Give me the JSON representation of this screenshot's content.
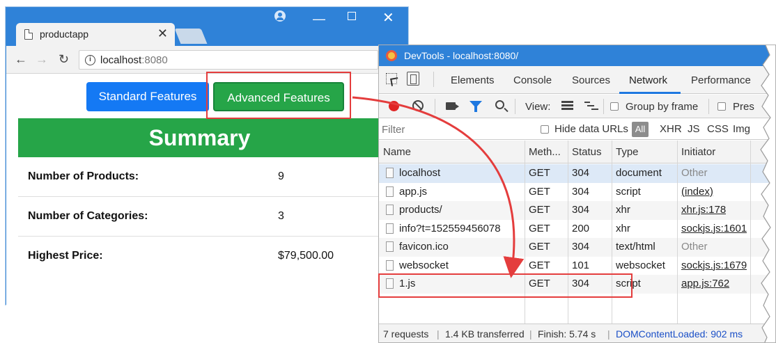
{
  "browser": {
    "tab_title": "productapp",
    "tab_close": "✕",
    "url_host": "localhost",
    "url_port": ":8080",
    "buttons": {
      "standard": "Standard Features",
      "advanced": "Advanced Features"
    },
    "summary_title": "Summary",
    "rows": [
      {
        "label": "Number of Products:",
        "value": "9"
      },
      {
        "label": "Number of Categories:",
        "value": "3"
      },
      {
        "label": "Highest Price:",
        "value": "$79,500.00"
      }
    ]
  },
  "devtools": {
    "title": "DevTools - localhost:8080/",
    "tabs": [
      "Elements",
      "Console",
      "Sources",
      "Network",
      "Performance"
    ],
    "active_tab": "Network",
    "toolbar": {
      "view_label": "View:",
      "group_by_frame": "Group by frame",
      "preserve_log": "Pres"
    },
    "filter_placeholder": "Filter",
    "hide_data_urls": "Hide data URLs",
    "all_label": "All",
    "type_filters": [
      "XHR",
      "JS",
      "CSS",
      "Img"
    ],
    "columns": [
      "Name",
      "Meth...",
      "Status",
      "Type",
      "Initiator"
    ],
    "requests": [
      {
        "name": "localhost",
        "method": "GET",
        "status": "304",
        "type": "document",
        "initiator": "Other"
      },
      {
        "name": "app.js",
        "method": "GET",
        "status": "304",
        "type": "script",
        "initiator": "(index)"
      },
      {
        "name": "products/",
        "method": "GET",
        "status": "304",
        "type": "xhr",
        "initiator": "xhr.js:178"
      },
      {
        "name": "info?t=152559456078",
        "method": "GET",
        "status": "200",
        "type": "xhr",
        "initiator": "sockjs.js:1601"
      },
      {
        "name": "favicon.ico",
        "method": "GET",
        "status": "304",
        "type": "text/html",
        "initiator": "Other"
      },
      {
        "name": "websocket",
        "method": "GET",
        "status": "101",
        "type": "websocket",
        "initiator": "sockjs.js:1679"
      },
      {
        "name": "1.js",
        "method": "GET",
        "status": "304",
        "type": "script",
        "initiator": "app.js:762"
      }
    ],
    "status_bar": {
      "requests": "7 requests",
      "transferred": "1.4 KB transferred",
      "finish": "Finish: 5.74 s",
      "dcl": "DOMContentLoaded: 902 ms"
    }
  },
  "colors": {
    "primary_blue": "#1479f4",
    "success_green": "#26a548",
    "annotation_red": "#e43d3d",
    "title_bar_blue": "#2f82d8"
  }
}
